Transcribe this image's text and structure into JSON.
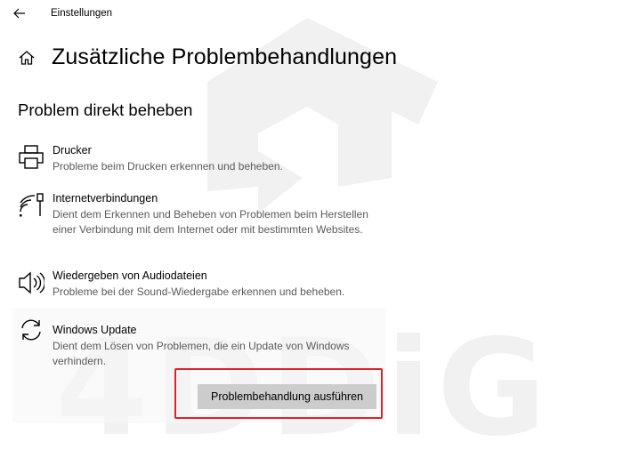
{
  "window": {
    "title": "Einstellungen"
  },
  "header": {
    "title": "Zusätzliche Problembehandlungen"
  },
  "section": {
    "title": "Problem direkt beheben"
  },
  "items": [
    {
      "name": "Drucker",
      "description": "Probleme beim Drucken erkennen und beheben.",
      "icon": "printer-icon"
    },
    {
      "name": "Internetverbindungen",
      "description": "Dient dem Erkennen und Beheben von Problemen beim Herstellen einer Verbindung mit dem Internet oder mit bestimmten Websites.",
      "icon": "network-icon"
    },
    {
      "name": "Wiedergeben von Audiodateien",
      "description": "Probleme bei der Sound-Wiedergabe erkennen und beheben.",
      "icon": "speaker-icon"
    },
    {
      "name": "Windows Update",
      "description": "Dient dem Lösen von Problemen, die ein Update von Windows verhindern.",
      "icon": "sync-icon",
      "selected": true
    }
  ],
  "actions": {
    "run_label": "Problembehandlung ausführen"
  },
  "watermark": {
    "text": "4DDiG"
  },
  "colors": {
    "highlight": "#d9252a",
    "button": "#cccccc",
    "secondary_text": "#5a5a5a"
  }
}
